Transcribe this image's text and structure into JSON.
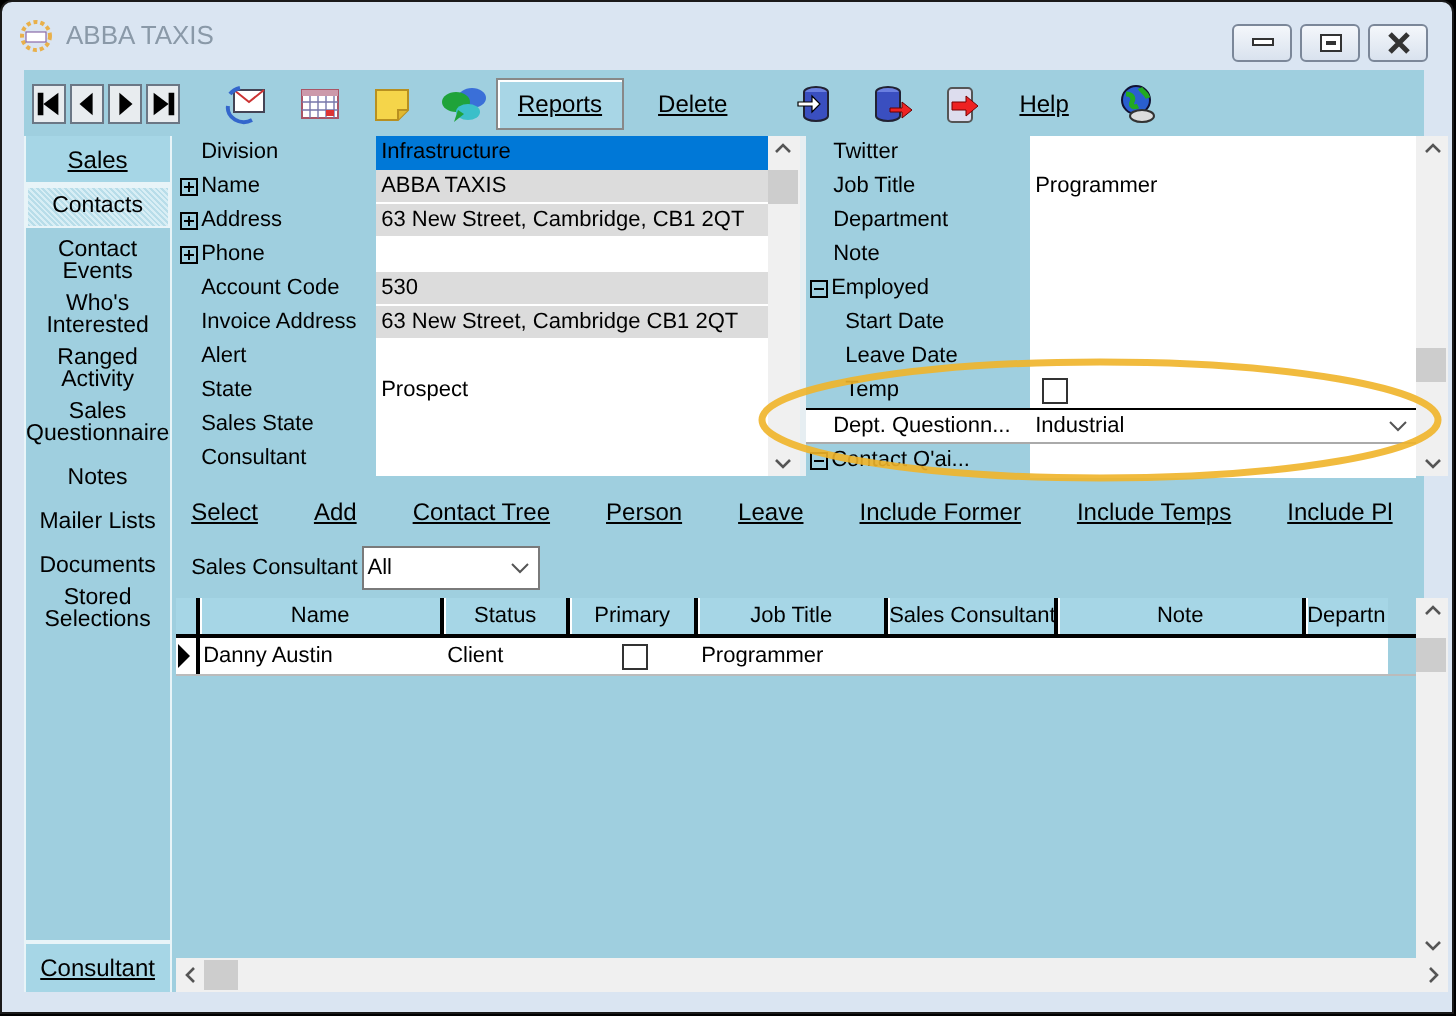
{
  "window": {
    "title": "ABBA TAXIS"
  },
  "toolbar": [
    {
      "kind": "button",
      "label": "Reports"
    },
    {
      "kind": "link",
      "label": "Delete"
    },
    {
      "kind": "link",
      "label": "Help"
    }
  ],
  "sidebar": {
    "top_button": "Sales",
    "items": [
      {
        "label": "Contacts",
        "selected": true
      },
      {
        "label": "Contact Events",
        "selected": false
      },
      {
        "label": "Who's Interested",
        "selected": false
      },
      {
        "label": "Ranged Activity",
        "selected": false
      },
      {
        "label": "Sales Questionnaire",
        "selected": false
      },
      {
        "label": "Notes",
        "selected": false
      },
      {
        "label": "Mailer Lists",
        "selected": false
      },
      {
        "label": "Documents",
        "selected": false
      },
      {
        "label": "Stored Selections",
        "selected": false
      }
    ],
    "bottom_button": "Consultant"
  },
  "company_fields": [
    {
      "label": "Division",
      "value": "Infrastructure",
      "selected": true,
      "readonly": false
    },
    {
      "label": "Name",
      "value": "ABBA TAXIS",
      "selected": false,
      "readonly": true,
      "expanded": false
    },
    {
      "label": "Address",
      "value": "63 New Street, Cambridge, CB1 2QT",
      "selected": false,
      "readonly": true,
      "expanded": false
    },
    {
      "label": "Phone",
      "selected": false,
      "readonly": false,
      "expanded": false
    },
    {
      "label": "Account Code",
      "value": "530",
      "selected": false,
      "readonly": true
    },
    {
      "label": "Invoice Address",
      "value": "63 New Street, Cambridge CB1 2QT",
      "selected": false,
      "readonly": true
    },
    {
      "label": "Alert",
      "selected": false,
      "readonly": false
    },
    {
      "label": "State",
      "value": "Prospect",
      "selected": false,
      "readonly": false
    },
    {
      "label": "Sales State",
      "selected": false,
      "readonly": false
    },
    {
      "label": "Consultant",
      "selected": false,
      "readonly": false
    }
  ],
  "contact_fields": [
    {
      "kind": "text",
      "label": "Twitter"
    },
    {
      "kind": "text",
      "label": "Job Title",
      "value": "Programmer"
    },
    {
      "kind": "text",
      "label": "Department"
    },
    {
      "kind": "text",
      "label": "Note"
    },
    {
      "kind": "group",
      "label": "Employed",
      "expanded": true,
      "children": [
        {
          "kind": "text",
          "label": "Start Date"
        },
        {
          "kind": "text",
          "label": "Leave Date"
        },
        {
          "kind": "checkbox",
          "label": "Temp",
          "checked": false
        }
      ]
    },
    {
      "kind": "dropdown",
      "label": "Dept. Questionn...",
      "value": "Industrial"
    },
    {
      "kind": "group",
      "label": "Contact Q'ai...",
      "expanded": true
    }
  ],
  "contacts": {
    "actions": [
      "Select",
      "Add",
      "Contact Tree",
      "Person",
      "Leave",
      "Include Former",
      "Include Temps",
      "Include Pl"
    ],
    "filter": {
      "label": "Sales Consultant",
      "value": "All"
    },
    "table": {
      "columns": [
        "Name",
        "Status",
        "Primary",
        "Job Title",
        "Sales Consultant",
        "Note",
        "Departn"
      ],
      "rows": [
        {
          "selected": true,
          "name": "Danny Austin",
          "status": "Client",
          "primary": false,
          "job_title": "Programmer"
        }
      ]
    }
  }
}
